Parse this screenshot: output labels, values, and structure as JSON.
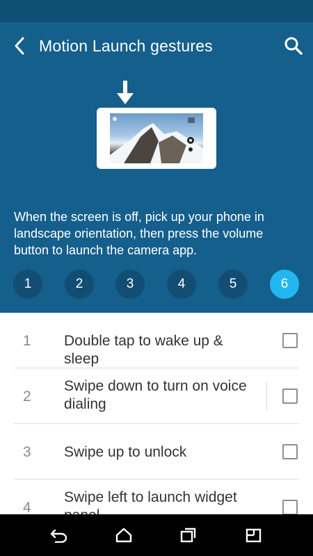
{
  "app_bar": {
    "title": "Motion Launch gestures",
    "back_icon": "back-chevron-icon",
    "search_icon": "search-icon"
  },
  "hero": {
    "illustration": "phone-landscape-camera-illustration",
    "arrow_icon": "arrow-down-icon"
  },
  "description": "When the screen is off, pick up your phone in landscape orientation, then press the volume button to launch the camera app.",
  "steps": {
    "items": [
      "1",
      "2",
      "3",
      "4",
      "5",
      "6"
    ],
    "active": 5
  },
  "gestures": [
    {
      "num": "1",
      "label": "Double tap to wake up & sleep",
      "checked": false
    },
    {
      "num": "2",
      "label": "Swipe down to turn on voice dialing",
      "checked": false
    },
    {
      "num": "3",
      "label": "Swipe up to unlock",
      "checked": false
    },
    {
      "num": "4",
      "label": "Swipe left to launch widget panel",
      "checked": false
    }
  ],
  "nav_bar": {
    "icons": [
      "back-icon",
      "home-icon",
      "recents-icon",
      "multi-window-icon"
    ]
  },
  "colors": {
    "primary": "#155f8c",
    "primary_dark": "#0f4e75",
    "step_inactive": "#124e74",
    "accent": "#22b7ef"
  }
}
